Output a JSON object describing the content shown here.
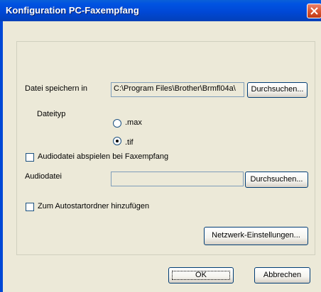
{
  "window": {
    "title": "Konfiguration PC-Faxempfang"
  },
  "form": {
    "save_in_label": "Datei speichern in",
    "save_in_value": "C:\\Program Files\\Brother\\Brmfl04a\\",
    "browse_label": "Durchsuchen...",
    "filetype_label": "Dateityp",
    "filetype_options": [
      {
        "label": ".max",
        "selected": false
      },
      {
        "label": ".tif",
        "selected": true
      }
    ],
    "play_audio_label": "Audiodatei abspielen bei Faxempfang",
    "play_audio_checked": false,
    "audio_label": "Audiodatei",
    "audio_value": "",
    "audio_browse_label": "Durchsuchen...",
    "autostart_label": "Zum Autostartordner hinzufügen",
    "autostart_checked": false,
    "network_button_label": "Netzwerk-Einstellungen..."
  },
  "footer": {
    "ok_label": "OK",
    "cancel_label": "Abbrechen"
  },
  "colors": {
    "titlebar": "#0048d6",
    "dialog_bg": "#ece9d8",
    "close_button": "#d9542f"
  }
}
